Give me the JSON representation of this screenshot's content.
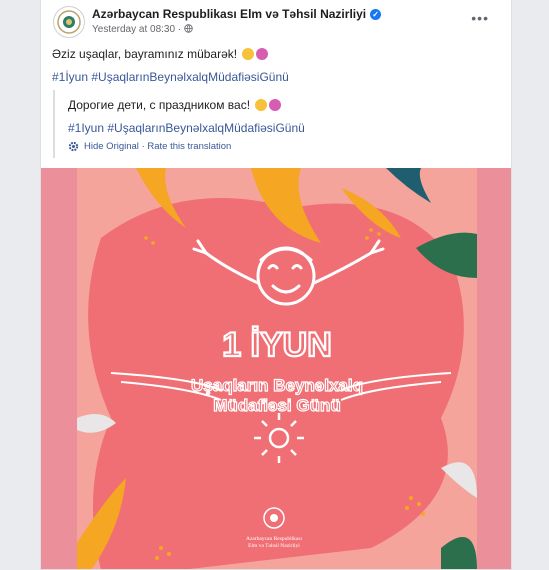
{
  "post": {
    "page_name": "Azərbaycan Respublikası Elm və Təhsil Nazirliyi",
    "timestamp": "Yesterday at 08:30 ·",
    "original_text": "Əziz uşaqlar, bayramınız mübarək!",
    "original_tags": "#1İyun #UşaqlarınBeynəlxalqMüdafiəsiGünü",
    "translated_text": "Дорогие дети, с праздником вас!",
    "translated_tags": "#1Іyun #UşaqlarınBeynəlxalqMüdafiəsiGünü",
    "hide_original": "Hide Original",
    "separator": "·",
    "rate_translation": "Rate this translation"
  },
  "image": {
    "headline": "1 İYUN",
    "subline_1": "Uşaqların Beynəlxalq",
    "subline_2": "Müdafiəsi Günü",
    "logo_line_1": "Azərbaycan Respublikası",
    "logo_line_2": "Elm və Təhsil Nazirliyi",
    "colors": {
      "background": "#eb8f9a",
      "panel": "#f4a49b",
      "center": "#f06f74",
      "leaf_orange": "#f5a623",
      "leaf_teal": "#1f5e6e",
      "leaf_green": "#2b6f4d"
    }
  }
}
